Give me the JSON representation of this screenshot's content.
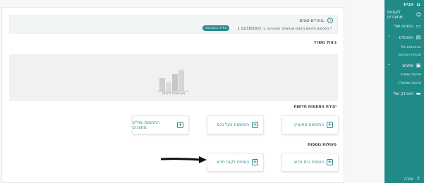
{
  "sidebar": {
    "items": [
      {
        "label": "הבית",
        "icon": "home-icon"
      },
      {
        "label": "לקוחות מחוברים",
        "icon": "users-icon"
      },
      {
        "label": "הפניות שלי",
        "icon": "inbox-icon"
      },
      {
        "label": "הסכמים",
        "icon": "document-icon"
      },
      {
        "label": "מתנים",
        "icon": "gift-icon"
      },
      {
        "label": "הארנק שלי",
        "icon": "wallet-icon"
      },
      {
        "label": "עזרה",
        "icon": "help-icon"
      }
    ],
    "sub_agreements": [
      "ההסכמים שלי",
      "תבניות הסכמים"
    ],
    "sub_gifts": [
      "מתנות שמצתי",
      "מתנות שמשמ\"ך"
    ]
  },
  "greeting": {
    "name": "צהריים טובים,",
    "info": "1 הסכמים חדשים נחתמו מכניסתך האחרונה ב- 11/10/2022 !",
    "badge": "צפייה בהסכמים"
  },
  "dashboard": {
    "title": "ניהול משרד",
    "empty_text": "אין נתונים להצגה"
  },
  "new_agreement": {
    "title": "יצירת התחמות חדשות",
    "buttons": [
      "התחמות מתעניין",
      "התחמות בעל נכס",
      "התחמות שת\"פ מתווכים"
    ]
  },
  "more_actions": {
    "title": "פעולות נוספות",
    "buttons": [
      "הוספת נכס חדש",
      "הוספת לקוח חדש"
    ]
  },
  "colors": {
    "accent": "#2a8a8a",
    "sidebar": "#1f8a86"
  }
}
